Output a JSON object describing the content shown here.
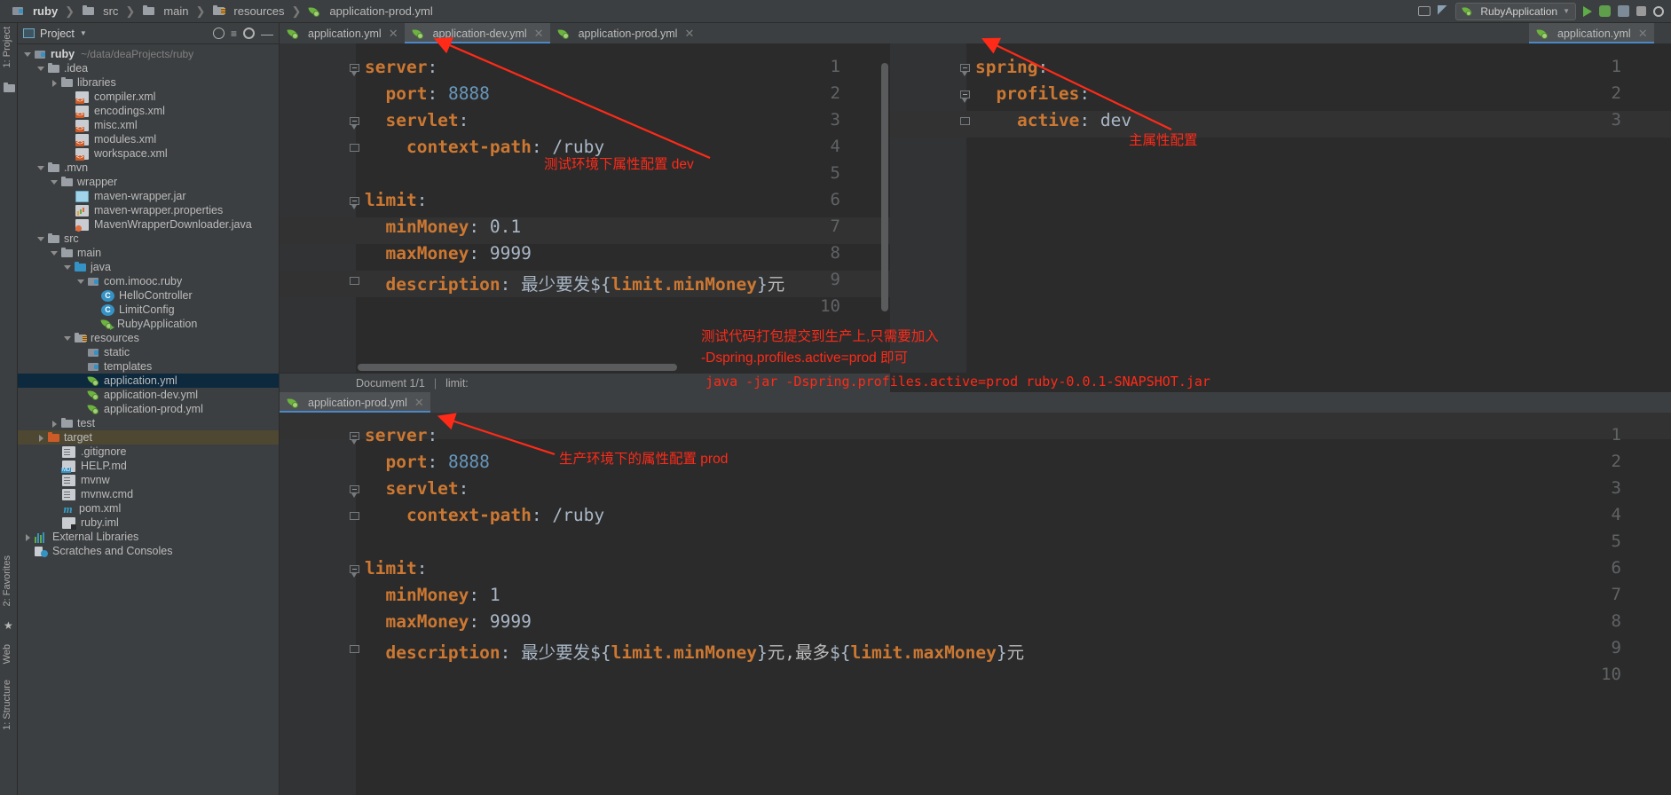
{
  "window": {
    "breadcrumbs": [
      {
        "label": "ruby",
        "icon": "module-icon",
        "bold": true
      },
      {
        "label": "src",
        "icon": "folder-icon",
        "bold": false
      },
      {
        "label": "main",
        "icon": "folder-icon",
        "bold": false
      },
      {
        "label": "resources",
        "icon": "resources-folder-icon",
        "bold": false
      },
      {
        "label": "application-prod.yml",
        "icon": "spring-yaml-icon",
        "bold": false
      }
    ],
    "run_configuration": "RubyApplication",
    "toolbar_icons": [
      "layout-icon",
      "build-icon",
      "run-icon",
      "debug-icon",
      "profile-icon",
      "stop-icon",
      "search-icon"
    ]
  },
  "left_strip": {
    "project_label": "1: Project",
    "structure_label": "1: Structure",
    "favorites_label": "2: Favorites",
    "web_label": "Web"
  },
  "project_panel": {
    "title": "Project",
    "tools": [
      "target-icon",
      "collapse-icon",
      "settings-icon",
      "hide-icon"
    ],
    "tree": [
      {
        "depth": 0,
        "arrow": "open",
        "icon": "module-icon",
        "label": "ruby",
        "path": "~/data/deaProjects/ruby",
        "bold": true,
        "state": "normal"
      },
      {
        "depth": 1,
        "arrow": "open",
        "icon": "folder-icon",
        "label": ".idea",
        "path": "",
        "bold": false,
        "state": "normal"
      },
      {
        "depth": 2,
        "arrow": "closed",
        "icon": "folder-icon",
        "label": "libraries",
        "path": "",
        "bold": false,
        "state": "normal"
      },
      {
        "depth": 3,
        "arrow": "none",
        "icon": "xml-icon",
        "label": "compiler.xml",
        "path": "",
        "bold": false,
        "state": "normal"
      },
      {
        "depth": 3,
        "arrow": "none",
        "icon": "xml-icon",
        "label": "encodings.xml",
        "path": "",
        "bold": false,
        "state": "normal"
      },
      {
        "depth": 3,
        "arrow": "none",
        "icon": "xml-icon",
        "label": "misc.xml",
        "path": "",
        "bold": false,
        "state": "normal"
      },
      {
        "depth": 3,
        "arrow": "none",
        "icon": "xml-icon",
        "label": "modules.xml",
        "path": "",
        "bold": false,
        "state": "normal"
      },
      {
        "depth": 3,
        "arrow": "none",
        "icon": "xml-icon",
        "label": "workspace.xml",
        "path": "",
        "bold": false,
        "state": "normal"
      },
      {
        "depth": 1,
        "arrow": "open",
        "icon": "folder-icon",
        "label": ".mvn",
        "path": "",
        "bold": false,
        "state": "normal"
      },
      {
        "depth": 2,
        "arrow": "open",
        "icon": "folder-icon",
        "label": "wrapper",
        "path": "",
        "bold": false,
        "state": "normal"
      },
      {
        "depth": 3,
        "arrow": "none",
        "icon": "jar-icon",
        "label": "maven-wrapper.jar",
        "path": "",
        "bold": false,
        "state": "normal"
      },
      {
        "depth": 3,
        "arrow": "none",
        "icon": "properties-icon",
        "label": "maven-wrapper.properties",
        "path": "",
        "bold": false,
        "state": "normal"
      },
      {
        "depth": 3,
        "arrow": "none",
        "icon": "java-file-icon",
        "label": "MavenWrapperDownloader.java",
        "path": "",
        "bold": false,
        "state": "normal"
      },
      {
        "depth": 1,
        "arrow": "open",
        "icon": "folder-icon",
        "label": "src",
        "path": "",
        "bold": false,
        "state": "normal"
      },
      {
        "depth": 2,
        "arrow": "open",
        "icon": "folder-icon",
        "label": "main",
        "path": "",
        "bold": false,
        "state": "normal"
      },
      {
        "depth": 3,
        "arrow": "open",
        "icon": "source-folder-icon",
        "label": "java",
        "path": "",
        "bold": false,
        "state": "normal"
      },
      {
        "depth": 4,
        "arrow": "open",
        "icon": "package-icon",
        "label": "com.imooc.ruby",
        "path": "",
        "bold": false,
        "state": "normal"
      },
      {
        "depth": 5,
        "arrow": "none",
        "icon": "class-icon",
        "label": "HelloController",
        "path": "",
        "bold": false,
        "state": "normal"
      },
      {
        "depth": 5,
        "arrow": "none",
        "icon": "class-icon",
        "label": "LimitConfig",
        "path": "",
        "bold": false,
        "state": "normal"
      },
      {
        "depth": 5,
        "arrow": "none",
        "icon": "spring-run-icon",
        "label": "RubyApplication",
        "path": "",
        "bold": false,
        "state": "normal"
      },
      {
        "depth": 3,
        "arrow": "open",
        "icon": "resources-folder-icon",
        "label": "resources",
        "path": "",
        "bold": false,
        "state": "normal"
      },
      {
        "depth": 4,
        "arrow": "none",
        "icon": "package-icon",
        "label": "static",
        "path": "",
        "bold": false,
        "state": "normal"
      },
      {
        "depth": 4,
        "arrow": "none",
        "icon": "package-icon",
        "label": "templates",
        "path": "",
        "bold": false,
        "state": "normal"
      },
      {
        "depth": 4,
        "arrow": "none",
        "icon": "spring-yaml-icon",
        "label": "application.yml",
        "path": "",
        "bold": false,
        "state": "selected"
      },
      {
        "depth": 4,
        "arrow": "none",
        "icon": "spring-yaml-icon",
        "label": "application-dev.yml",
        "path": "",
        "bold": false,
        "state": "normal"
      },
      {
        "depth": 4,
        "arrow": "none",
        "icon": "spring-yaml-icon",
        "label": "application-prod.yml",
        "path": "",
        "bold": false,
        "state": "normal"
      },
      {
        "depth": 2,
        "arrow": "closed",
        "icon": "folder-icon",
        "label": "test",
        "path": "",
        "bold": false,
        "state": "normal"
      },
      {
        "depth": 1,
        "arrow": "closed",
        "icon": "target-folder-icon",
        "label": "target",
        "path": "",
        "bold": false,
        "state": "highlight"
      },
      {
        "depth": 2,
        "arrow": "none",
        "icon": "text-file-icon",
        "label": ".gitignore",
        "path": "",
        "bold": false,
        "state": "normal"
      },
      {
        "depth": 2,
        "arrow": "none",
        "icon": "markdown-icon",
        "label": "HELP.md",
        "path": "",
        "bold": false,
        "state": "normal"
      },
      {
        "depth": 2,
        "arrow": "none",
        "icon": "text-file-icon",
        "label": "mvnw",
        "path": "",
        "bold": false,
        "state": "normal"
      },
      {
        "depth": 2,
        "arrow": "none",
        "icon": "text-file-icon",
        "label": "mvnw.cmd",
        "path": "",
        "bold": false,
        "state": "normal"
      },
      {
        "depth": 2,
        "arrow": "none",
        "icon": "maven-icon",
        "label": "pom.xml",
        "path": "",
        "bold": false,
        "state": "normal"
      },
      {
        "depth": 2,
        "arrow": "none",
        "icon": "iml-icon",
        "label": "ruby.iml",
        "path": "",
        "bold": false,
        "state": "normal"
      },
      {
        "depth": 0,
        "arrow": "closed",
        "icon": "library-icon",
        "label": "External Libraries",
        "path": "",
        "bold": false,
        "state": "normal"
      },
      {
        "depth": 0,
        "arrow": "none",
        "icon": "scratches-icon",
        "label": "Scratches and Consoles",
        "path": "",
        "bold": false,
        "state": "normal"
      }
    ]
  },
  "editor": {
    "top_tabs": [
      {
        "label": "application.yml",
        "active": false,
        "icon": "spring-yaml-icon"
      },
      {
        "label": "application-dev.yml",
        "active": true,
        "icon": "spring-yaml-icon"
      },
      {
        "label": "application-prod.yml",
        "active": false,
        "icon": "spring-yaml-icon"
      }
    ],
    "right_tabs": [
      {
        "label": "application.yml",
        "active": true,
        "icon": "spring-yaml-icon"
      }
    ],
    "bottom_tabs": [
      {
        "label": "application-prod.yml",
        "active": true,
        "icon": "spring-yaml-icon"
      }
    ],
    "dev_pane": {
      "lines": [
        {
          "n": "1",
          "indent": 0,
          "key": "server",
          "colon": ":",
          "value": "",
          "vtype": "none"
        },
        {
          "n": "2",
          "indent": 2,
          "key": "port",
          "colon": ":",
          "value": "8888",
          "vtype": "num"
        },
        {
          "n": "3",
          "indent": 2,
          "key": "servlet",
          "colon": ":",
          "value": "",
          "vtype": "none"
        },
        {
          "n": "4",
          "indent": 4,
          "key": "context-path",
          "colon": ":",
          "value": "/ruby",
          "vtype": "str"
        },
        {
          "n": "5",
          "indent": 0,
          "key": "",
          "colon": "",
          "value": "",
          "vtype": "none"
        },
        {
          "n": "6",
          "indent": 0,
          "key": "limit",
          "colon": ":",
          "value": "",
          "vtype": "none"
        },
        {
          "n": "7",
          "indent": 2,
          "key": "minMoney",
          "colon": ":",
          "value": "0.1",
          "vtype": "str"
        },
        {
          "n": "8",
          "indent": 2,
          "key": "maxMoney",
          "colon": ":",
          "value": "9999",
          "vtype": "str"
        },
        {
          "n": "9",
          "indent": 2,
          "key": "description",
          "colon": ":",
          "value": "最少要发${limit.minMoney}元",
          "vtype": "tpl"
        },
        {
          "n": "10",
          "indent": 0,
          "key": "",
          "colon": "",
          "value": "",
          "vtype": "none"
        }
      ]
    },
    "main_pane": {
      "lines": [
        {
          "n": "1",
          "indent": 0,
          "key": "spring",
          "colon": ":",
          "value": "",
          "vtype": "none"
        },
        {
          "n": "2",
          "indent": 2,
          "key": "profiles",
          "colon": ":",
          "value": "",
          "vtype": "none"
        },
        {
          "n": "3",
          "indent": 4,
          "key": "active",
          "colon": ":",
          "value": "dev",
          "vtype": "str"
        }
      ]
    },
    "prod_pane": {
      "lines": [
        {
          "n": "1",
          "indent": 0,
          "key": "server",
          "colon": ":",
          "value": "",
          "vtype": "none"
        },
        {
          "n": "2",
          "indent": 2,
          "key": "port",
          "colon": ":",
          "value": "8888",
          "vtype": "num"
        },
        {
          "n": "3",
          "indent": 2,
          "key": "servlet",
          "colon": ":",
          "value": "",
          "vtype": "none"
        },
        {
          "n": "4",
          "indent": 4,
          "key": "context-path",
          "colon": ":",
          "value": "/ruby",
          "vtype": "str"
        },
        {
          "n": "5",
          "indent": 0,
          "key": "",
          "colon": "",
          "value": "",
          "vtype": "none"
        },
        {
          "n": "6",
          "indent": 0,
          "key": "limit",
          "colon": ":",
          "value": "",
          "vtype": "none"
        },
        {
          "n": "7",
          "indent": 2,
          "key": "minMoney",
          "colon": ":",
          "value": "1",
          "vtype": "str"
        },
        {
          "n": "8",
          "indent": 2,
          "key": "maxMoney",
          "colon": ":",
          "value": "9999",
          "vtype": "str"
        },
        {
          "n": "9",
          "indent": 2,
          "key": "description",
          "colon": ":",
          "value": "最少要发${limit.minMoney}元,最多${limit.maxMoney}元",
          "vtype": "tpl"
        },
        {
          "n": "10",
          "indent": 0,
          "key": "",
          "colon": "",
          "value": "",
          "vtype": "none"
        }
      ]
    },
    "doc_status": {
      "document": "Document 1/1",
      "breadcrumb": "limit:"
    }
  },
  "annotations": {
    "dev_note": "测试环境下属性配置 dev",
    "main_note": "主属性配置",
    "prod_note": "生产环境下的属性配置 prod",
    "deploy_line1": "测试代码打包提交到生产上,只需要加入",
    "deploy_line2": "-Dspring.profiles.active=prod 即可",
    "command": "java -jar -Dspring.profiles.active=prod ruby-0.0.1-SNAPSHOT.jar",
    "color": "#ff2a18"
  }
}
